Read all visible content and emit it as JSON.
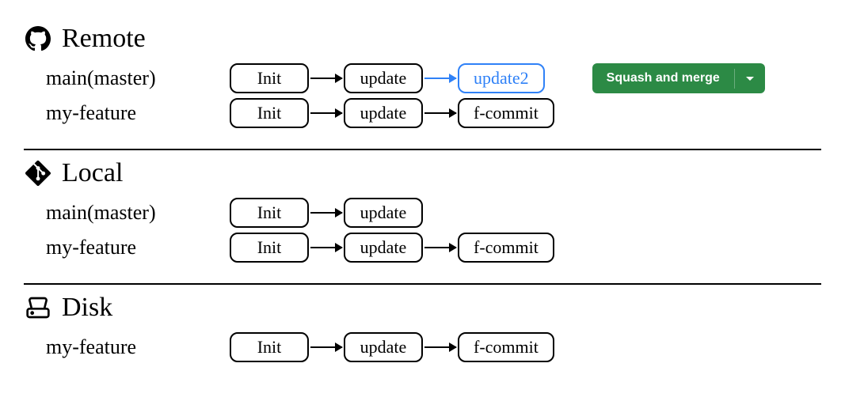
{
  "sections": {
    "remote": {
      "title": "Remote",
      "branches": {
        "main": {
          "label": "main(master)",
          "commits": [
            "Init",
            "update",
            "update2"
          ],
          "highlightLast": true
        },
        "feature": {
          "label": "my-feature",
          "commits": [
            "Init",
            "update",
            "f-commit"
          ]
        }
      },
      "button": {
        "label": "Squash and merge"
      }
    },
    "local": {
      "title": "Local",
      "branches": {
        "main": {
          "label": "main(master)",
          "commits": [
            "Init",
            "update"
          ]
        },
        "feature": {
          "label": "my-feature",
          "commits": [
            "Init",
            "update",
            "f-commit"
          ]
        }
      }
    },
    "disk": {
      "title": "Disk",
      "branches": {
        "feature": {
          "label": "my-feature",
          "commits": [
            "Init",
            "update",
            "f-commit"
          ]
        }
      }
    }
  },
  "colors": {
    "highlight": "#2f81f7",
    "buttonBg": "#2c8a45"
  }
}
